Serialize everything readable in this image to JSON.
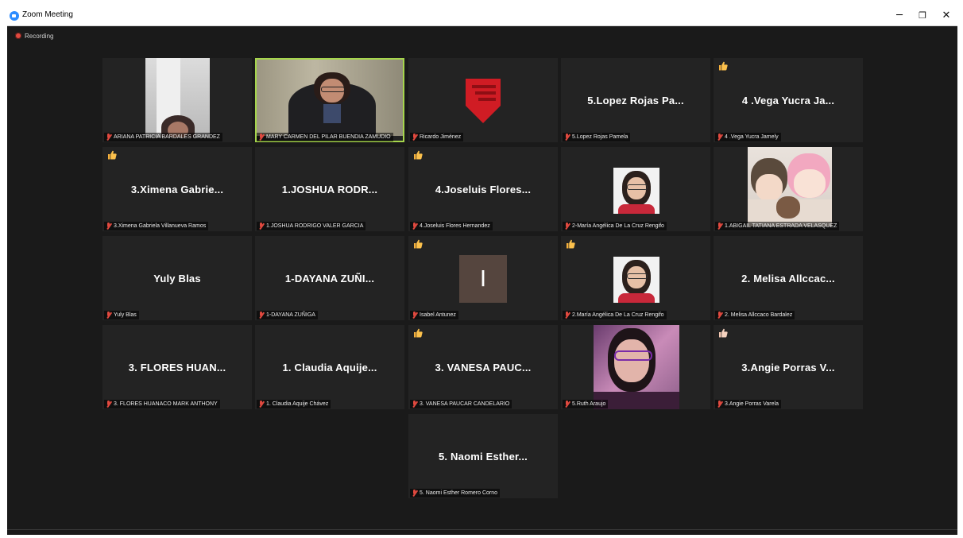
{
  "window": {
    "title": "Zoom Meeting",
    "min_glyph": "─",
    "restore_glyph": "❐",
    "close_glyph": "✕"
  },
  "recording": {
    "label": "Recording"
  },
  "colors": {
    "accent": "#2d8cff",
    "active_speaker": "#a6d64c",
    "muted": "#e0493f",
    "reaction": "#f6b13c"
  },
  "tiles": [
    {
      "tag": "ARIANA PATRICIA BARDALES GRANDEZ",
      "center": "",
      "video": "ariana",
      "thumb": false
    },
    {
      "tag": "MARY CARMEN DEL PILAR BUENDIA ZAMUDIO",
      "center": "",
      "video": "mary",
      "thumb": false,
      "active": true
    },
    {
      "tag": "Ricardo Jiménez",
      "center": "",
      "video": "logo",
      "thumb": false
    },
    {
      "tag": "5.Lopez Rojas Pamela",
      "center": "5.Lopez Rojas Pa...",
      "video": "",
      "thumb": false
    },
    {
      "tag": "4 .Vega Yucra Jamely",
      "center": "4 .Vega Yucra Ja...",
      "video": "",
      "thumb": true
    },
    {
      "tag": "3.Ximena Gabriela Villanueva Ramos",
      "center": "3.Ximena Gabrie...",
      "video": "",
      "thumb": true
    },
    {
      "tag": "1.JOSHUA RODRIGO VALER GARCIA",
      "center": "1.JOSHUA RODR...",
      "video": "",
      "thumb": false
    },
    {
      "tag": "4.Joseluis Flores Hernandez",
      "center": "4.Joseluis Flores...",
      "video": "",
      "thumb": true
    },
    {
      "tag": "2-María Angélica De La Cruz Rengifo",
      "center": "",
      "video": "maria",
      "thumb": false
    },
    {
      "tag": "1.ABIGAIL TATIANA ESTRADA VELASQUEZ",
      "center": "",
      "video": "anime",
      "thumb": false
    },
    {
      "tag": "Yuly Blas",
      "center": "Yuly Blas",
      "video": "",
      "thumb": false
    },
    {
      "tag": "1-DAYANA ZUÑIGA",
      "center": "1-DAYANA ZUÑI...",
      "video": "",
      "thumb": false
    },
    {
      "tag": "Isabel Antunez",
      "center": "",
      "video": "initial",
      "initial": "I",
      "thumb": true
    },
    {
      "tag": "2.María Angélica De La Cruz Rengifo",
      "center": "",
      "video": "maria",
      "thumb": true
    },
    {
      "tag": "2. Melisa Allccaco Bardalez",
      "center": "2. Melisa Allccac...",
      "video": "",
      "thumb": false
    },
    {
      "tag": "3. FLORES HUANACO MARK ANTHONY",
      "center": "3. FLORES HUAN...",
      "video": "",
      "thumb": false
    },
    {
      "tag": "1. Claudia Aquije Chávez",
      "center": "1. Claudia Aquije...",
      "video": "",
      "thumb": false
    },
    {
      "tag": "3. VANESA PAUCAR CANDELARIO",
      "center": "3. VANESA PAUC...",
      "video": "",
      "thumb": true
    },
    {
      "tag": "5.Ruth Araujo",
      "center": "",
      "video": "ruth",
      "thumb": false
    },
    {
      "tag": "3.Angie Porras Varela",
      "center": "3.Angie Porras V...",
      "video": "",
      "thumb": true,
      "thumb_light": true
    },
    {
      "tag": "5. Naomi Esther Romero Corno",
      "center": "5. Naomi Esther...",
      "video": "",
      "thumb": false
    }
  ]
}
